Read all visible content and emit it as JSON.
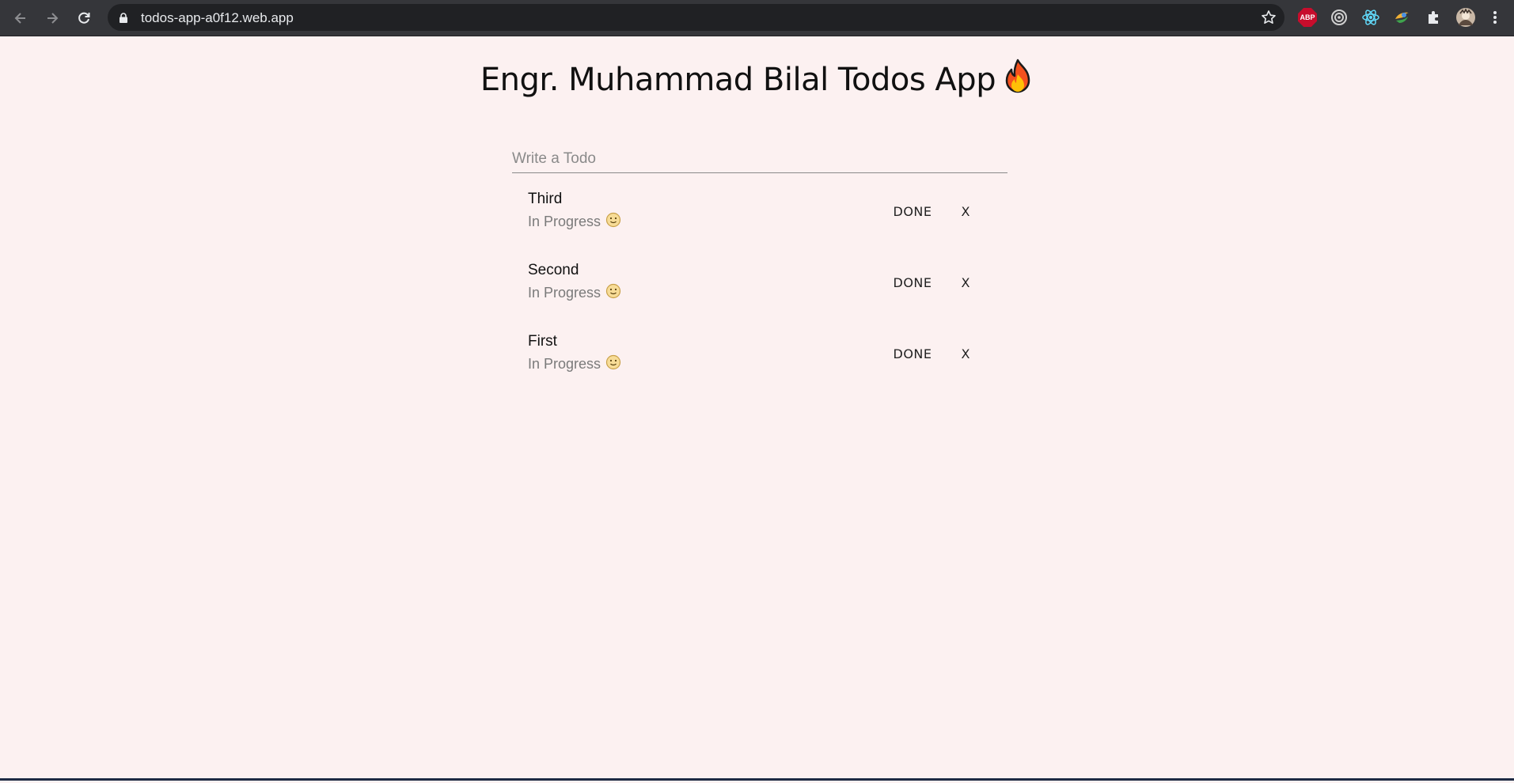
{
  "browser": {
    "url": "todos-app-a0f12.web.app",
    "extensions": [
      "adblock-plus-icon",
      "target-icon",
      "react-devtools-icon",
      "colorful-extension-icon",
      "puzzle-icon",
      "profile-avatar"
    ],
    "abp_label": "ABP"
  },
  "app": {
    "title": "Engr. Muhammad Bilal Todos App",
    "title_emoji": "fire-icon"
  },
  "input": {
    "placeholder": "Write a Todo",
    "value": ""
  },
  "todos": [
    {
      "text": "Third",
      "status": "In Progress",
      "done_label": "DONE",
      "delete_label": "X"
    },
    {
      "text": "Second",
      "status": "In Progress",
      "done_label": "DONE",
      "delete_label": "X"
    },
    {
      "text": "First",
      "status": "In Progress",
      "done_label": "DONE",
      "delete_label": "X"
    }
  ],
  "colors": {
    "page_background": "#fcf1f1",
    "chrome_toolbar": "#35363a",
    "status_text": "#7a7a7a"
  }
}
